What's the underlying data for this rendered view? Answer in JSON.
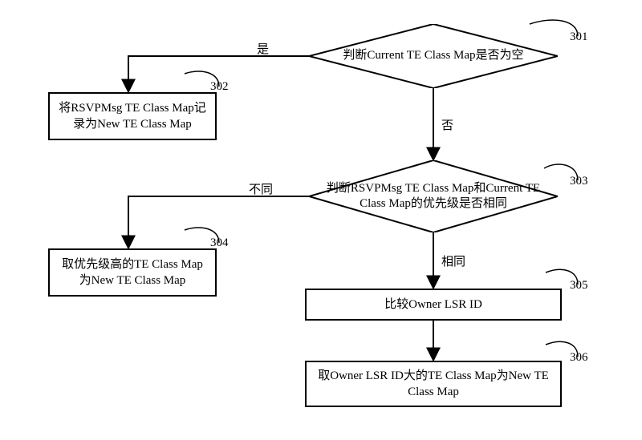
{
  "steps": {
    "s301": {
      "num": "301",
      "text": "判断Current TE Class Map是否为空"
    },
    "s302": {
      "num": "302",
      "text": "将RSVPMsg TE Class Map记录为New TE Class Map"
    },
    "s303": {
      "num": "303",
      "text": "判断RSVPMsg TE Class Map和Current TE Class Map的优先级是否相同"
    },
    "s304": {
      "num": "304",
      "text": "取优先级高的TE Class Map为New TE Class Map"
    },
    "s305": {
      "num": "305",
      "text": "比较Owner LSR ID"
    },
    "s306": {
      "num": "306",
      "text": "取Owner LSR ID大的TE Class Map为New TE Class Map"
    }
  },
  "edges": {
    "yes": "是",
    "no": "否",
    "diff": "不同",
    "same": "相同"
  }
}
